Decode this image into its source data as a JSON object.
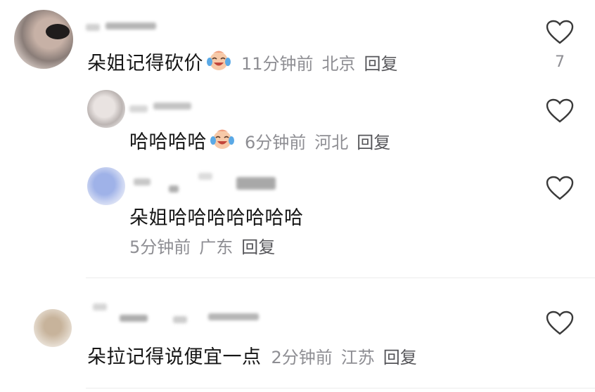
{
  "comments": [
    {
      "text": "朵姐记得砍价",
      "emoji": "crying-laughing-emoji",
      "time": "11分钟前",
      "location": "北京",
      "reply_label": "回复",
      "likes": "7"
    },
    {
      "text": "哈哈哈哈",
      "emoji": "crying-laughing-emoji",
      "time": "6分钟前",
      "location": "河北",
      "reply_label": "回复"
    },
    {
      "text": "朵姐哈哈哈哈哈哈哈",
      "time": "5分钟前",
      "location": "广东",
      "reply_label": "回复"
    },
    {
      "text": "朵拉记得说便宜一点",
      "time": "2分钟前",
      "location": "江苏",
      "reply_label": "回复"
    }
  ],
  "colors": {
    "text": "#161616",
    "meta": "#8e8e93",
    "divider": "#ececec"
  }
}
